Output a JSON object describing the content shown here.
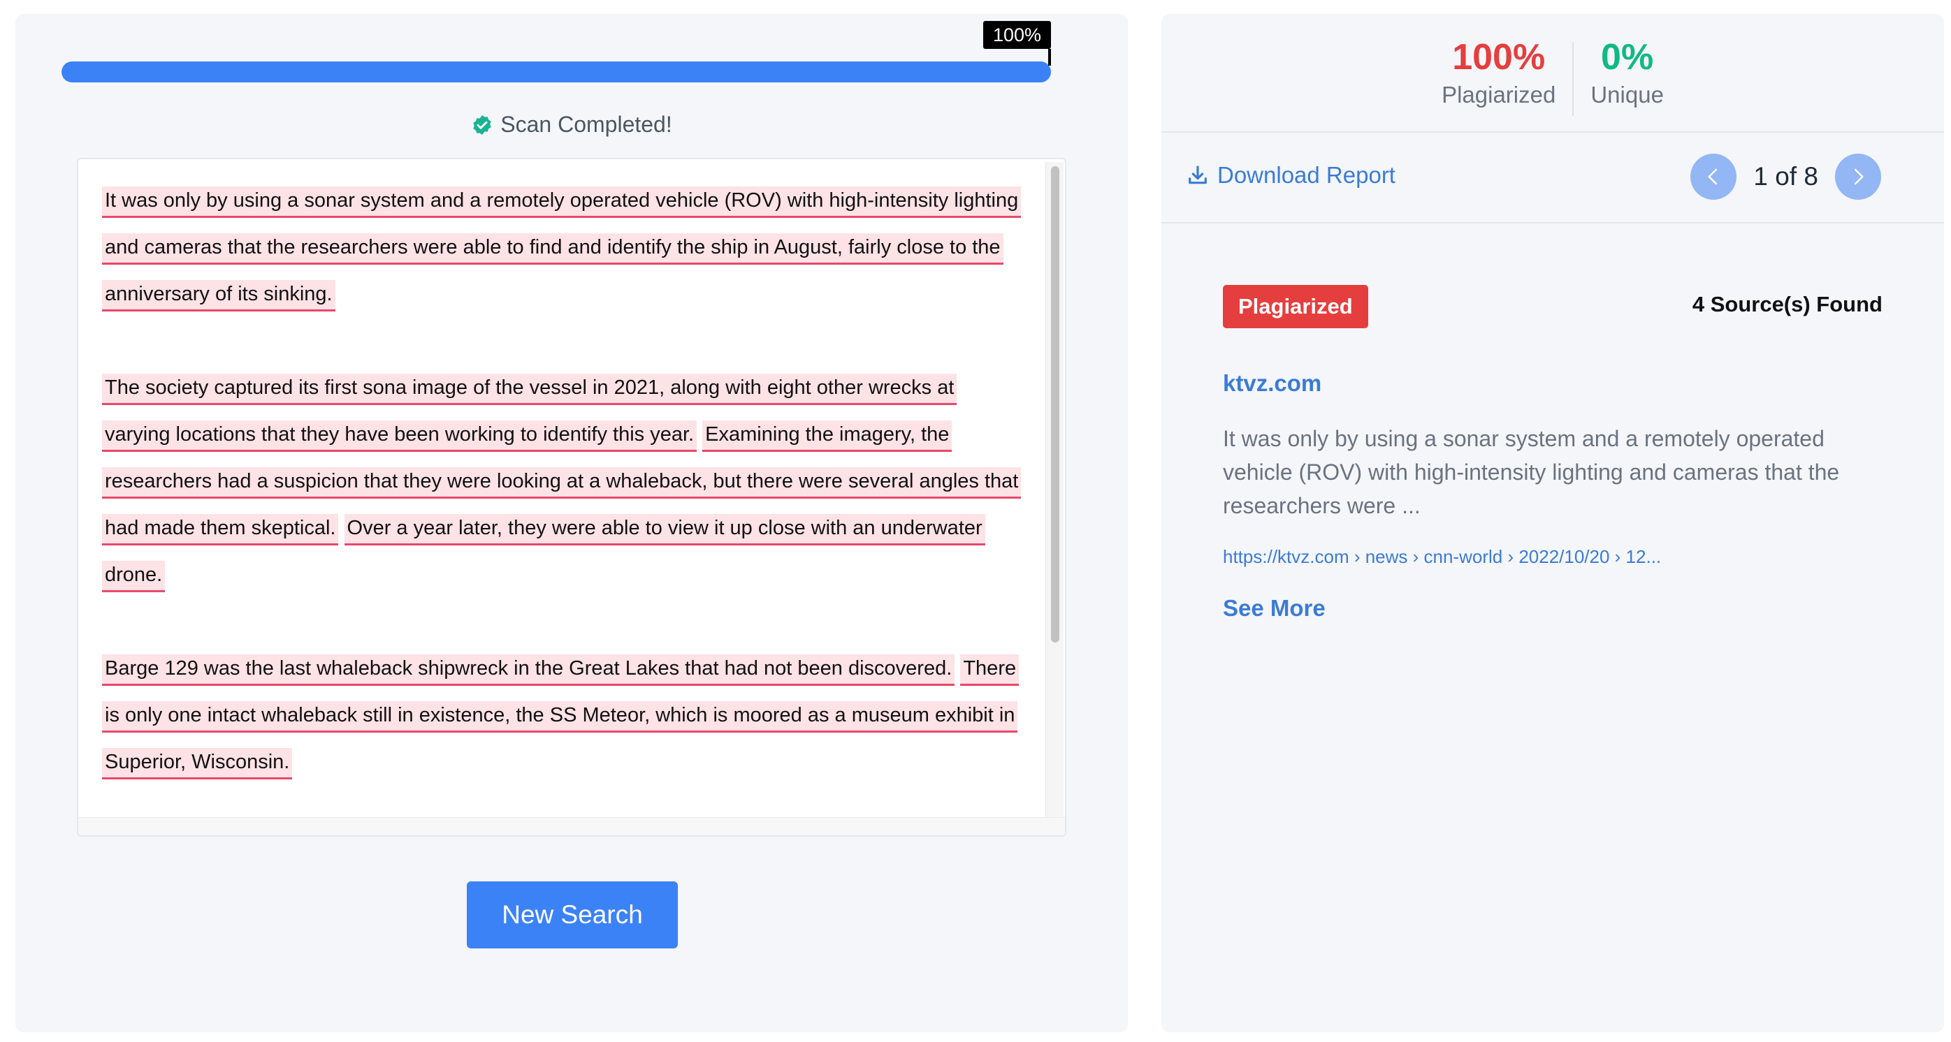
{
  "progress": {
    "percent": 100,
    "label": "100%"
  },
  "scan": {
    "status_text": "Scan Completed!"
  },
  "document": {
    "paragraphs": [
      [
        "It was only by using a sonar system and a remotely operated vehicle (ROV) with high-intensity lighting and cameras that the researchers were able to find and identify the ship in August, fairly close to the anniversary of its sinking."
      ],
      [
        "The society captured its first sona image of the vessel in 2021, along with eight other wrecks at varying locations that they have been working to identify this year.",
        "Examining the imagery, the researchers had a suspicion that they were looking at a whaleback, but there were several angles that had made them skeptical.",
        "Over a year later, they were able to view it up close with an underwater drone."
      ],
      [
        "Barge 129 was the last whaleback shipwreck in the Great Lakes that had not been discovered.",
        "There is only one intact whaleback still in existence, the SS Meteor, which is moored as a museum exhibit in Superior, Wisconsin."
      ]
    ]
  },
  "actions": {
    "new_search_label": "New Search"
  },
  "stats": {
    "plagiarized_value": "100%",
    "plagiarized_label": "Plagiarized",
    "unique_value": "0%",
    "unique_label": "Unique"
  },
  "toolbar": {
    "download_label": "Download Report",
    "pager_text": "1 of 8"
  },
  "result": {
    "badge": "Plagiarized",
    "sources_found": "4 Source(s) Found",
    "domain": "ktvz.com",
    "snippet": "It was only by using a sonar system and a remotely operated vehicle (ROV) with high-intensity lighting and cameras that the researchers were ...",
    "url": "https://ktvz.com › news › cnn-world › 2022/10/20 › 12...",
    "see_more": "See More"
  },
  "colors": {
    "accent": "#3b82f6",
    "plagiarized": "#e53e3e",
    "unique": "#10b981",
    "highlight_bg": "#fde2e6",
    "highlight_underline": "#e8486b"
  },
  "icons": {
    "status": "check-circle-icon",
    "download": "download-icon",
    "prev": "chevron-left-icon",
    "next": "chevron-right-icon"
  }
}
